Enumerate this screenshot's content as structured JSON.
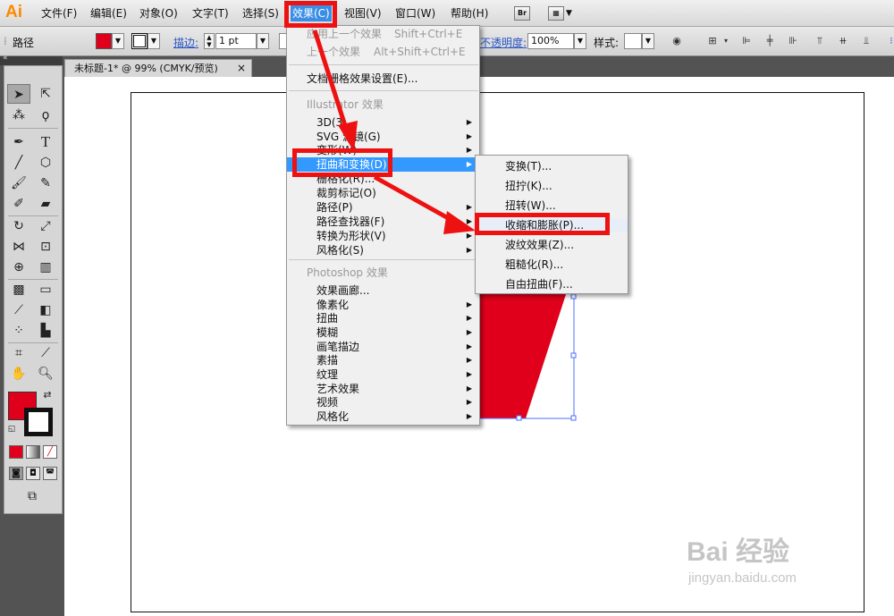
{
  "menubar": {
    "logo": "Ai",
    "items": [
      "文件(F)",
      "编辑(E)",
      "对象(O)",
      "文字(T)",
      "选择(S)",
      "效果(C)",
      "视图(V)",
      "窗口(W)",
      "帮助(H)"
    ],
    "bridge_label": "Br",
    "active_index": 5
  },
  "control_bar": {
    "object_type": "路径",
    "stroke_link": "描边:",
    "stroke_weight": "1 pt",
    "opacity_link": "不透明度:",
    "opacity_value": "100%",
    "style_label": "样式:",
    "fill_color": "#e0001b"
  },
  "document": {
    "tab_title": "未标题-1* @ 99% (CMYK/预览)",
    "shape_fill": "#e0001b",
    "selection_color": "#4b6fff"
  },
  "effect_menu": {
    "items": [
      {
        "label": "应用上一个效果",
        "shortcut": "Shift+Ctrl+E",
        "disabled": true
      },
      {
        "label": "上一个效果",
        "shortcut": "Alt+Shift+Ctrl+E",
        "disabled": true
      },
      {
        "label": "文档栅格效果设置(E)..."
      },
      {
        "label": "Illustrator 效果",
        "header": true
      },
      {
        "label": "3D(3)",
        "submenu": true
      },
      {
        "label": "SVG 滤镜(G)",
        "submenu": true
      },
      {
        "label": "变形(W)",
        "submenu": true
      },
      {
        "label": "扭曲和变换(D)",
        "submenu": true,
        "highlighted": true
      },
      {
        "label": "栅格化(R)..."
      },
      {
        "label": "裁剪标记(O)"
      },
      {
        "label": "路径(P)",
        "submenu": true
      },
      {
        "label": "路径查找器(F)",
        "submenu": true
      },
      {
        "label": "转换为形状(V)",
        "submenu": true
      },
      {
        "label": "风格化(S)",
        "submenu": true
      },
      {
        "label": "Photoshop 效果",
        "header": true
      },
      {
        "label": "效果画廊..."
      },
      {
        "label": "像素化",
        "submenu": true
      },
      {
        "label": "扭曲",
        "submenu": true
      },
      {
        "label": "模糊",
        "submenu": true
      },
      {
        "label": "画笔描边",
        "submenu": true
      },
      {
        "label": "素描",
        "submenu": true
      },
      {
        "label": "纹理",
        "submenu": true
      },
      {
        "label": "艺术效果",
        "submenu": true
      },
      {
        "label": "视频",
        "submenu": true
      },
      {
        "label": "风格化",
        "submenu": true
      }
    ]
  },
  "distort_submenu": {
    "items": [
      "变换(T)...",
      "扭拧(K)...",
      "扭转(W)...",
      "收缩和膨胀(P)...",
      "波纹效果(Z)...",
      "粗糙化(R)...",
      "自由扭曲(F)..."
    ],
    "highlighted_index": 3
  },
  "annotation_color": "#ee1111",
  "watermark": {
    "main": "Bai 经验",
    "sub": "jingyan.baidu.com"
  }
}
